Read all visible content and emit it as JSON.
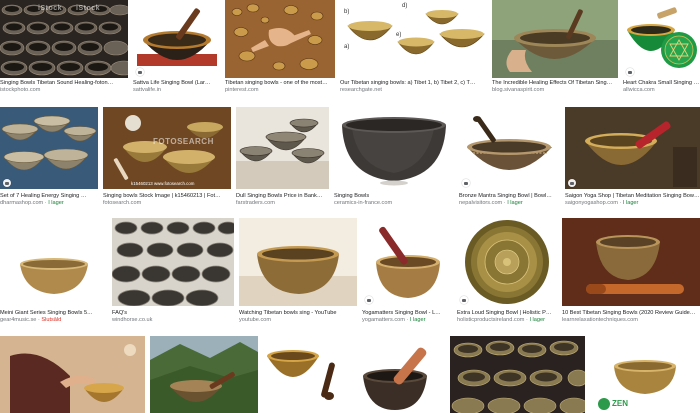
{
  "colors": {
    "title": "#202124",
    "source": "#70757a",
    "stock": "#188038",
    "sale": "#d93025"
  },
  "results": [
    {
      "title": "Singing Bowls Tibetan Sound Healing-foton…",
      "source": "istockphoto.com"
    },
    {
      "title": "Sattva Life Singing Bowl (Lar…",
      "source": "sattvalife.in"
    },
    {
      "title": "Tibetan singing bowls - one of the most…",
      "source": "pinterest.com"
    },
    {
      "title": "Our Tibetan singing bowls: a) Tibet 1, b) Tibet 2, c) T…",
      "source": "researchgate.net"
    },
    {
      "title": "The Incredible Healing Effects Of Tibetan Sing…",
      "source": "blog.sivanaspirit.com"
    },
    {
      "title": "Heart Chakra Small Singing …",
      "source": "allwicca.com"
    },
    {
      "title": "Set of 7 Healing Energy Singing …",
      "source": "dharmashop.com",
      "stock": "I lager"
    },
    {
      "title": "Singing bowls Stock Image | k15460213 | Fot…",
      "source": "fotosearch.com"
    },
    {
      "title": "Dull Singing Bowls Price in Bank…",
      "source": "farstraders.com"
    },
    {
      "title": "Singing Bowls",
      "source": "ceramics-in-france.com"
    },
    {
      "title": "Bronze Mantra Singing Bowl | Bowl…",
      "source": "nepalvisitors.com",
      "stock": "I lager"
    },
    {
      "title": "Saigon Yoga Shop | Tibetan Meditation Singing Bow…",
      "source": "saigonyogashop.com",
      "stock": "I lager"
    },
    {
      "title": "Meini Giant Series Singing Bowls 5…",
      "source": "gear4music.se",
      "sale": "Slutsåld"
    },
    {
      "title": "FAQ's",
      "source": "windhorse.co.uk"
    },
    {
      "title": "Watching Tibetan bowls sing - YouTube",
      "source": "youtube.com"
    },
    {
      "title": "Yogamatters Singing Bowl - L…",
      "source": "yogamatters.com",
      "stock": "I lager"
    },
    {
      "title": "Extra Loud Singing Bowl | Holistic P…",
      "source": "holisticproductsireland.com",
      "stock": "I lager"
    },
    {
      "title": "10 Best Tibetan Singing Bowls (2020 Review Guide…",
      "source": "learnrelaxationtechniques.com"
    },
    {},
    {},
    {},
    {},
    {},
    {}
  ],
  "watermarks": {
    "istock": "iStock",
    "fotosearch": "FOTOSEARCH",
    "fotosearch_id": "k15460213 www.fotosearch.com",
    "research_labels": [
      "a)",
      "b)",
      "c)",
      "d)",
      "e)"
    ],
    "zen": "ZEN"
  }
}
